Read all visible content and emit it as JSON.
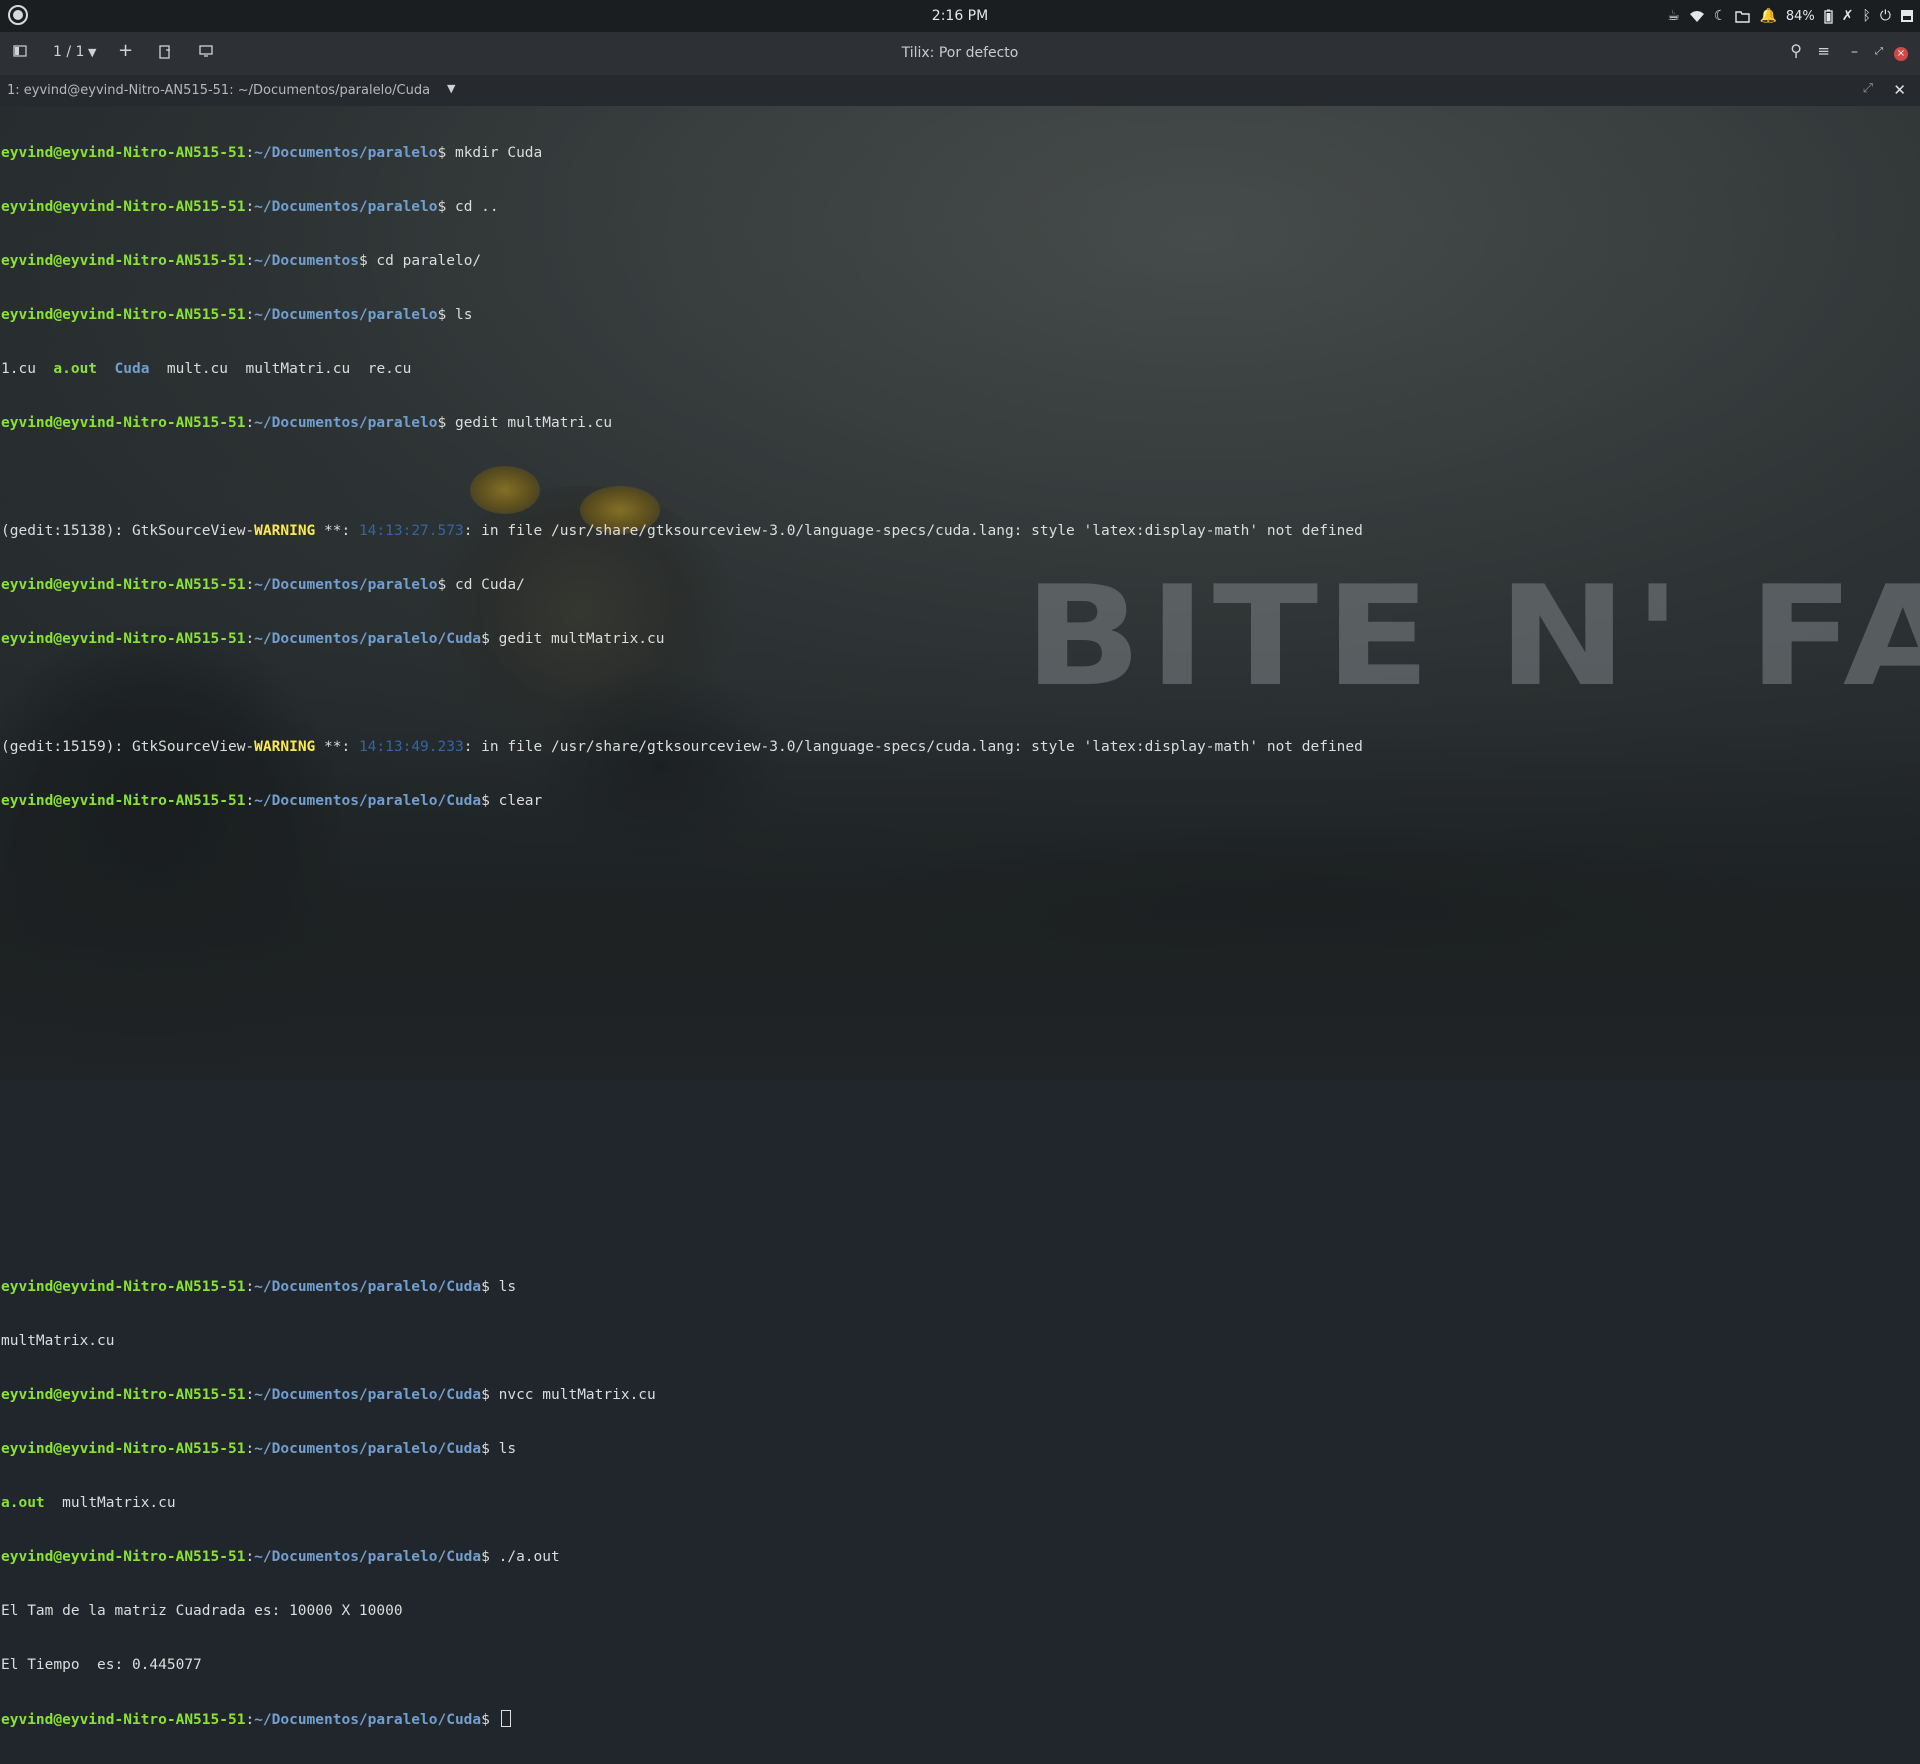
{
  "system_bar": {
    "clock": "2:16 PM",
    "battery": "84%",
    "icons": [
      "cup-icon",
      "wifi-icon",
      "moon-icon",
      "folder-icon",
      "bell-icon",
      "battery-icon",
      "tools-icon",
      "bluetooth-icon",
      "power-icon",
      "menu-icon"
    ]
  },
  "window": {
    "title": "Tilix: Por defecto",
    "session_counter": "1 / 1"
  },
  "tab": {
    "title": "1: eyvind@eyvind-Nitro-AN515-51: ~/Documentos/paralelo/Cuda"
  },
  "terminal": {
    "user_host": "eyvind@eyvind-Nitro-AN515-51",
    "path_paralelo": "~/Documentos/paralelo",
    "path_documentos": "~/Documentos",
    "path_cuda": "~/Documentos/paralelo/Cuda",
    "commands": {
      "c1": " mkdir Cuda",
      "c2": " cd ..",
      "c3": " cd paralelo/",
      "c4": " ls",
      "c5": " gedit multMatri.cu",
      "c6": " cd Cuda/",
      "c7": " gedit multMatrix.cu",
      "c8": " clear",
      "c9": " ls",
      "c10": " nvcc multMatrix.cu",
      "c11": " ls",
      "c12": " ./a.out"
    },
    "ls1": {
      "f1": "1.cu",
      "f2": "a.out",
      "f3": "Cuda",
      "f4": "mult.cu",
      "f5": "multMatri.cu",
      "f6": "re.cu"
    },
    "warn1": {
      "prefix": "(gedit:15138): GtkSourceView-",
      "level": "WARNING",
      "mid": " **: ",
      "time": "14:13:27.573",
      "msg": ": in file /usr/share/gtksourceview-3.0/language-specs/cuda.lang: style 'latex:display-math' not defined"
    },
    "warn2": {
      "prefix": "(gedit:15159): GtkSourceView-",
      "level": "WARNING",
      "mid": " **: ",
      "time": "14:13:49.233",
      "msg": ": in file /usr/share/gtksourceview-3.0/language-specs/cuda.lang: style 'latex:display-math' not defined"
    },
    "ls2": "multMatrix.cu",
    "ls3": {
      "f1": "a.out",
      "f2": "multMatrix.cu"
    },
    "out1": "El Tam de la matriz Cuadrada es: 10000 X 10000",
    "out2": "El Tiempo  es: 0.445077"
  },
  "wallpaper": {
    "text": "BITE N' FAL"
  }
}
